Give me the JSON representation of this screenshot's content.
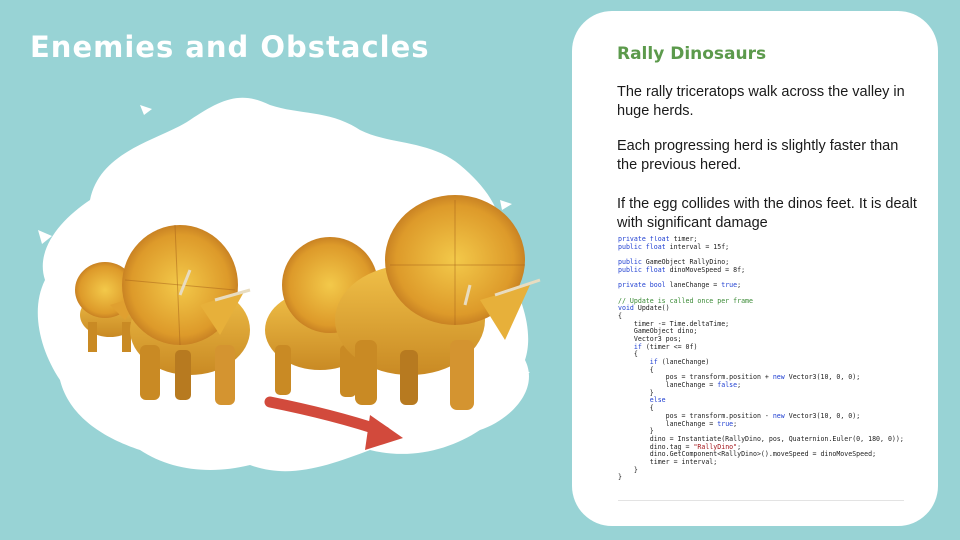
{
  "slide": {
    "title": "Enemies and Obstacles",
    "background_color": "#98d3d5"
  },
  "illustration": {
    "subject": "herd of triceratops walking on white paint splash",
    "arrow_color": "#d24a3c"
  },
  "card": {
    "title": "Rally Dinosaurs",
    "title_color": "#5c9a4c",
    "paragraphs": [
      "The rally triceratops walk across the valley in huge herds.",
      "Each progressing herd is slightly faster than the previous hered.",
      "If the  egg collides with the dinos feet. It is dealt with significant damage"
    ],
    "code_lines": [
      [
        {
          "t": "private float",
          "c": "kw"
        },
        {
          "t": " timer;"
        }
      ],
      [
        {
          "t": "public float",
          "c": "kw"
        },
        {
          "t": " interval = 15f;"
        }
      ],
      [
        {
          "t": ""
        }
      ],
      [
        {
          "t": "public",
          "c": "kw"
        },
        {
          "t": " GameObject RallyDino;"
        }
      ],
      [
        {
          "t": "public float",
          "c": "kw"
        },
        {
          "t": " dinoMoveSpeed = 8f;"
        }
      ],
      [
        {
          "t": ""
        }
      ],
      [
        {
          "t": "private bool",
          "c": "kw"
        },
        {
          "t": " laneChange = "
        },
        {
          "t": "true",
          "c": "kw"
        },
        {
          "t": ";"
        }
      ],
      [
        {
          "t": ""
        }
      ],
      [
        {
          "t": "// Update is called once per frame",
          "c": "cm"
        }
      ],
      [
        {
          "t": "void",
          "c": "kw"
        },
        {
          "t": " Update()"
        }
      ],
      [
        {
          "t": "{"
        }
      ],
      [
        {
          "t": "    timer -= Time.deltaTime;"
        }
      ],
      [
        {
          "t": "    GameObject dino;"
        }
      ],
      [
        {
          "t": "    Vector3 pos;"
        }
      ],
      [
        {
          "t": "    "
        },
        {
          "t": "if",
          "c": "kw"
        },
        {
          "t": " (timer <= 0f)"
        }
      ],
      [
        {
          "t": "    {"
        }
      ],
      [
        {
          "t": "        "
        },
        {
          "t": "if",
          "c": "kw"
        },
        {
          "t": " (laneChange)"
        }
      ],
      [
        {
          "t": "        {"
        }
      ],
      [
        {
          "t": "            pos = transform.position + "
        },
        {
          "t": "new",
          "c": "kw"
        },
        {
          "t": " Vector3(10, 0, 0);"
        }
      ],
      [
        {
          "t": "            laneChange = "
        },
        {
          "t": "false",
          "c": "kw"
        },
        {
          "t": ";"
        }
      ],
      [
        {
          "t": "        }"
        }
      ],
      [
        {
          "t": "        "
        },
        {
          "t": "else",
          "c": "kw"
        }
      ],
      [
        {
          "t": "        {"
        }
      ],
      [
        {
          "t": "            pos = transform.position - "
        },
        {
          "t": "new",
          "c": "kw"
        },
        {
          "t": " Vector3(10, 0, 0);"
        }
      ],
      [
        {
          "t": "            laneChange = "
        },
        {
          "t": "true",
          "c": "kw"
        },
        {
          "t": ";"
        }
      ],
      [
        {
          "t": "        }"
        }
      ],
      [
        {
          "t": "        dino = Instantiate(RallyDino, pos, Quaternion.Euler(0, 180, 0));"
        }
      ],
      [
        {
          "t": "        dino.tag = "
        },
        {
          "t": "\"RallyDino\"",
          "c": "st"
        },
        {
          "t": ";"
        }
      ],
      [
        {
          "t": "        dino.GetComponent<RallyDino>().moveSpeed = dinoMoveSpeed;"
        }
      ],
      [
        {
          "t": "        timer = interval;"
        }
      ],
      [
        {
          "t": "    }"
        }
      ],
      [
        {
          "t": "}"
        }
      ]
    ]
  }
}
